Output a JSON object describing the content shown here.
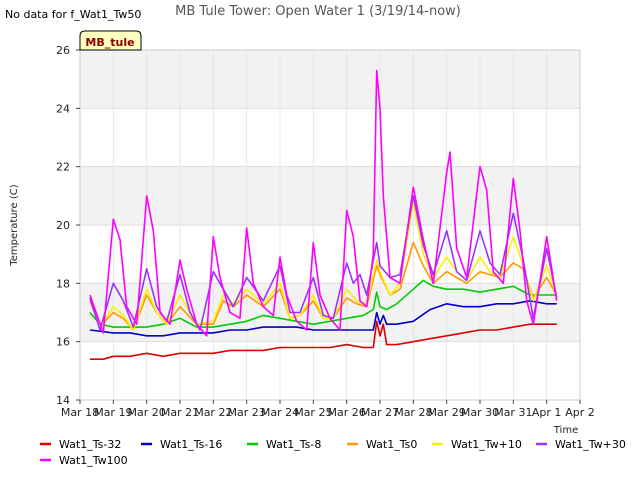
{
  "chart_data": {
    "type": "line",
    "title": "MB Tule Tower: Open Water 1 (3/19/14-now)",
    "note": "No data for f_Wat1_Tw50",
    "badge": "MB_tule",
    "xlabel": "Time",
    "ylabel": "Temperature (C)",
    "xlim": [
      0,
      15
    ],
    "ylim": [
      14,
      26
    ],
    "x_ticks": [
      {
        "x": 0,
        "label": "Mar 18"
      },
      {
        "x": 1,
        "label": "Mar 19"
      },
      {
        "x": 2,
        "label": "Mar 20"
      },
      {
        "x": 3,
        "label": "Mar 21"
      },
      {
        "x": 4,
        "label": "Mar 22"
      },
      {
        "x": 5,
        "label": "Mar 23"
      },
      {
        "x": 6,
        "label": "Mar 24"
      },
      {
        "x": 7,
        "label": "Mar 25"
      },
      {
        "x": 8,
        "label": "Mar 26"
      },
      {
        "x": 9,
        "label": "Mar 27"
      },
      {
        "x": 10,
        "label": "Mar 28"
      },
      {
        "x": 11,
        "label": "Mar 29"
      },
      {
        "x": 12,
        "label": "Mar 30"
      },
      {
        "x": 13,
        "label": "Mar 31"
      },
      {
        "x": 14,
        "label": "Apr 1"
      },
      {
        "x": 15,
        "label": "Apr 2"
      }
    ],
    "y_ticks": [
      14,
      16,
      18,
      20,
      22,
      24,
      26
    ],
    "grid": true,
    "legend_position": "bottom",
    "series": [
      {
        "name": "Wat1_Ts-32",
        "color": "#dd0000",
        "x": [
          0.3,
          0.7,
          1.0,
          1.5,
          2.0,
          2.5,
          3.0,
          3.5,
          4.0,
          4.5,
          5.0,
          5.5,
          6.0,
          6.5,
          7.0,
          7.5,
          8.0,
          8.5,
          8.8,
          8.9,
          9.0,
          9.1,
          9.2,
          9.5,
          10.0,
          10.5,
          11.0,
          11.5,
          12.0,
          12.5,
          13.0,
          13.5,
          14.0,
          14.3
        ],
        "y": [
          15.4,
          15.4,
          15.5,
          15.5,
          15.6,
          15.5,
          15.6,
          15.6,
          15.6,
          15.7,
          15.7,
          15.7,
          15.8,
          15.8,
          15.8,
          15.8,
          15.9,
          15.8,
          15.8,
          16.7,
          16.2,
          16.6,
          15.9,
          15.9,
          16.0,
          16.1,
          16.2,
          16.3,
          16.4,
          16.4,
          16.5,
          16.6,
          16.6,
          16.6
        ]
      },
      {
        "name": "Wat1_Ts-16",
        "color": "#0000cc",
        "x": [
          0.3,
          1.0,
          1.5,
          2.0,
          2.5,
          3.0,
          3.5,
          4.0,
          4.5,
          5.0,
          5.5,
          6.0,
          6.5,
          7.0,
          7.5,
          8.0,
          8.5,
          8.8,
          8.9,
          9.0,
          9.1,
          9.2,
          9.5,
          10.0,
          10.5,
          11.0,
          11.5,
          12.0,
          12.5,
          13.0,
          13.5,
          14.0,
          14.3
        ],
        "y": [
          16.4,
          16.3,
          16.3,
          16.2,
          16.2,
          16.3,
          16.3,
          16.3,
          16.4,
          16.4,
          16.5,
          16.5,
          16.5,
          16.4,
          16.4,
          16.4,
          16.4,
          16.4,
          17.0,
          16.6,
          16.9,
          16.6,
          16.6,
          16.7,
          17.1,
          17.3,
          17.2,
          17.2,
          17.3,
          17.3,
          17.4,
          17.3,
          17.3
        ]
      },
      {
        "name": "Wat1_Ts-8",
        "color": "#00cc00",
        "x": [
          0.3,
          0.6,
          1.0,
          1.5,
          2.0,
          2.5,
          3.0,
          3.5,
          4.0,
          4.5,
          5.0,
          5.5,
          6.0,
          6.5,
          7.0,
          7.5,
          8.0,
          8.5,
          8.8,
          8.9,
          9.0,
          9.2,
          9.5,
          10.0,
          10.3,
          10.6,
          11.0,
          11.5,
          12.0,
          12.5,
          13.0,
          13.5,
          14.0,
          14.3
        ],
        "y": [
          17.0,
          16.6,
          16.5,
          16.5,
          16.5,
          16.6,
          16.8,
          16.5,
          16.5,
          16.6,
          16.7,
          16.9,
          16.8,
          16.7,
          16.6,
          16.7,
          16.8,
          16.9,
          17.1,
          17.7,
          17.2,
          17.1,
          17.3,
          17.8,
          18.1,
          17.9,
          17.8,
          17.8,
          17.7,
          17.8,
          17.9,
          17.6,
          17.6,
          17.6
        ]
      },
      {
        "name": "Wat1_Ts0",
        "color": "#ff9900",
        "x": [
          0.3,
          0.6,
          1.0,
          1.3,
          1.6,
          2.0,
          2.3,
          2.6,
          3.0,
          3.5,
          4.0,
          4.3,
          4.6,
          5.0,
          5.5,
          6.0,
          6.3,
          6.6,
          7.0,
          7.3,
          7.6,
          8.0,
          8.3,
          8.6,
          8.9,
          9.0,
          9.3,
          9.6,
          10.0,
          10.3,
          10.6,
          11.0,
          11.3,
          11.6,
          12.0,
          12.3,
          12.6,
          13.0,
          13.3,
          13.6,
          14.0,
          14.3
        ],
        "y": [
          17.4,
          16.5,
          17.0,
          16.8,
          16.4,
          17.6,
          17.0,
          16.6,
          17.2,
          16.6,
          16.6,
          17.4,
          17.2,
          17.6,
          17.2,
          17.8,
          16.8,
          16.9,
          17.4,
          16.8,
          16.8,
          17.5,
          17.3,
          17.2,
          18.6,
          18.3,
          17.6,
          17.8,
          19.4,
          18.6,
          18.0,
          18.4,
          18.2,
          18.0,
          18.4,
          18.3,
          18.2,
          18.7,
          18.5,
          17.5,
          18.2,
          17.6
        ]
      },
      {
        "name": "Wat1_Tw+10",
        "color": "#ffee00",
        "x": [
          0.3,
          0.6,
          1.0,
          1.3,
          1.6,
          2.0,
          2.3,
          2.6,
          3.0,
          3.5,
          4.0,
          4.3,
          4.6,
          5.0,
          5.5,
          6.0,
          6.3,
          6.6,
          7.0,
          7.3,
          7.6,
          8.0,
          8.3,
          8.6,
          8.9,
          9.0,
          9.3,
          9.6,
          10.0,
          10.3,
          10.6,
          11.0,
          11.3,
          11.6,
          12.0,
          12.3,
          12.6,
          13.0,
          13.3,
          13.6,
          14.0,
          14.3
        ],
        "y": [
          17.6,
          16.5,
          17.2,
          16.9,
          16.4,
          17.8,
          17.0,
          16.6,
          17.6,
          16.6,
          16.7,
          17.6,
          17.3,
          17.8,
          17.3,
          18.0,
          16.8,
          16.9,
          17.6,
          16.8,
          16.8,
          17.8,
          17.4,
          17.3,
          18.8,
          18.4,
          17.6,
          18.0,
          20.8,
          19.0,
          18.2,
          18.9,
          18.4,
          18.1,
          18.9,
          18.4,
          18.2,
          19.6,
          18.6,
          17.4,
          18.6,
          17.6
        ]
      },
      {
        "name": "Wat1_Tw+30",
        "color": "#9933ff",
        "x": [
          0.3,
          0.6,
          1.0,
          1.3,
          1.6,
          2.0,
          2.3,
          2.6,
          3.0,
          3.3,
          3.6,
          4.0,
          4.3,
          4.6,
          5.0,
          5.5,
          6.0,
          6.3,
          6.6,
          7.0,
          7.3,
          7.6,
          8.0,
          8.2,
          8.4,
          8.6,
          8.9,
          9.0,
          9.3,
          9.6,
          10.0,
          10.3,
          10.6,
          11.0,
          11.3,
          11.6,
          12.0,
          12.3,
          12.6,
          13.0,
          13.3,
          13.6,
          14.0,
          14.3
        ],
        "y": [
          17.5,
          16.4,
          18.0,
          17.4,
          16.5,
          18.5,
          17.2,
          16.7,
          18.3,
          17.0,
          16.4,
          18.4,
          17.8,
          17.2,
          18.2,
          17.4,
          18.6,
          17.0,
          17.0,
          18.2,
          16.9,
          16.8,
          18.7,
          18.0,
          18.3,
          17.6,
          19.4,
          18.6,
          18.2,
          18.3,
          21.0,
          19.3,
          18.3,
          19.8,
          18.4,
          18.1,
          19.8,
          18.7,
          18.3,
          20.4,
          18.8,
          16.8,
          19.2,
          17.5
        ]
      },
      {
        "name": "Wat1_Tw100",
        "color": "#ff00ff",
        "x": [
          0.3,
          0.7,
          1.0,
          1.2,
          1.4,
          1.7,
          2.0,
          2.2,
          2.4,
          2.7,
          3.0,
          3.2,
          3.5,
          3.8,
          4.0,
          4.2,
          4.5,
          4.8,
          5.0,
          5.2,
          5.5,
          5.8,
          6.0,
          6.2,
          6.5,
          6.8,
          7.0,
          7.2,
          7.5,
          7.8,
          8.0,
          8.2,
          8.4,
          8.6,
          8.8,
          8.9,
          9.0,
          9.1,
          9.3,
          9.6,
          10.0,
          10.3,
          10.6,
          11.0,
          11.1,
          11.3,
          11.6,
          12.0,
          12.2,
          12.4,
          12.7,
          13.0,
          13.2,
          13.4,
          13.6,
          14.0,
          14.3
        ],
        "y": [
          17.6,
          16.3,
          20.2,
          19.5,
          17.2,
          16.6,
          21.0,
          19.8,
          17.0,
          16.6,
          18.8,
          17.8,
          16.6,
          16.2,
          19.6,
          18.2,
          17.0,
          16.8,
          19.9,
          18.0,
          17.2,
          16.9,
          18.9,
          17.6,
          16.7,
          16.4,
          19.4,
          17.6,
          16.8,
          16.4,
          20.5,
          19.6,
          17.4,
          17.2,
          19.0,
          25.3,
          24.0,
          21.0,
          18.2,
          18.0,
          21.3,
          19.5,
          18.0,
          21.8,
          22.5,
          19.2,
          18.2,
          22.0,
          21.2,
          18.4,
          18.0,
          21.6,
          19.8,
          17.4,
          16.6,
          19.6,
          17.4
        ]
      }
    ]
  }
}
